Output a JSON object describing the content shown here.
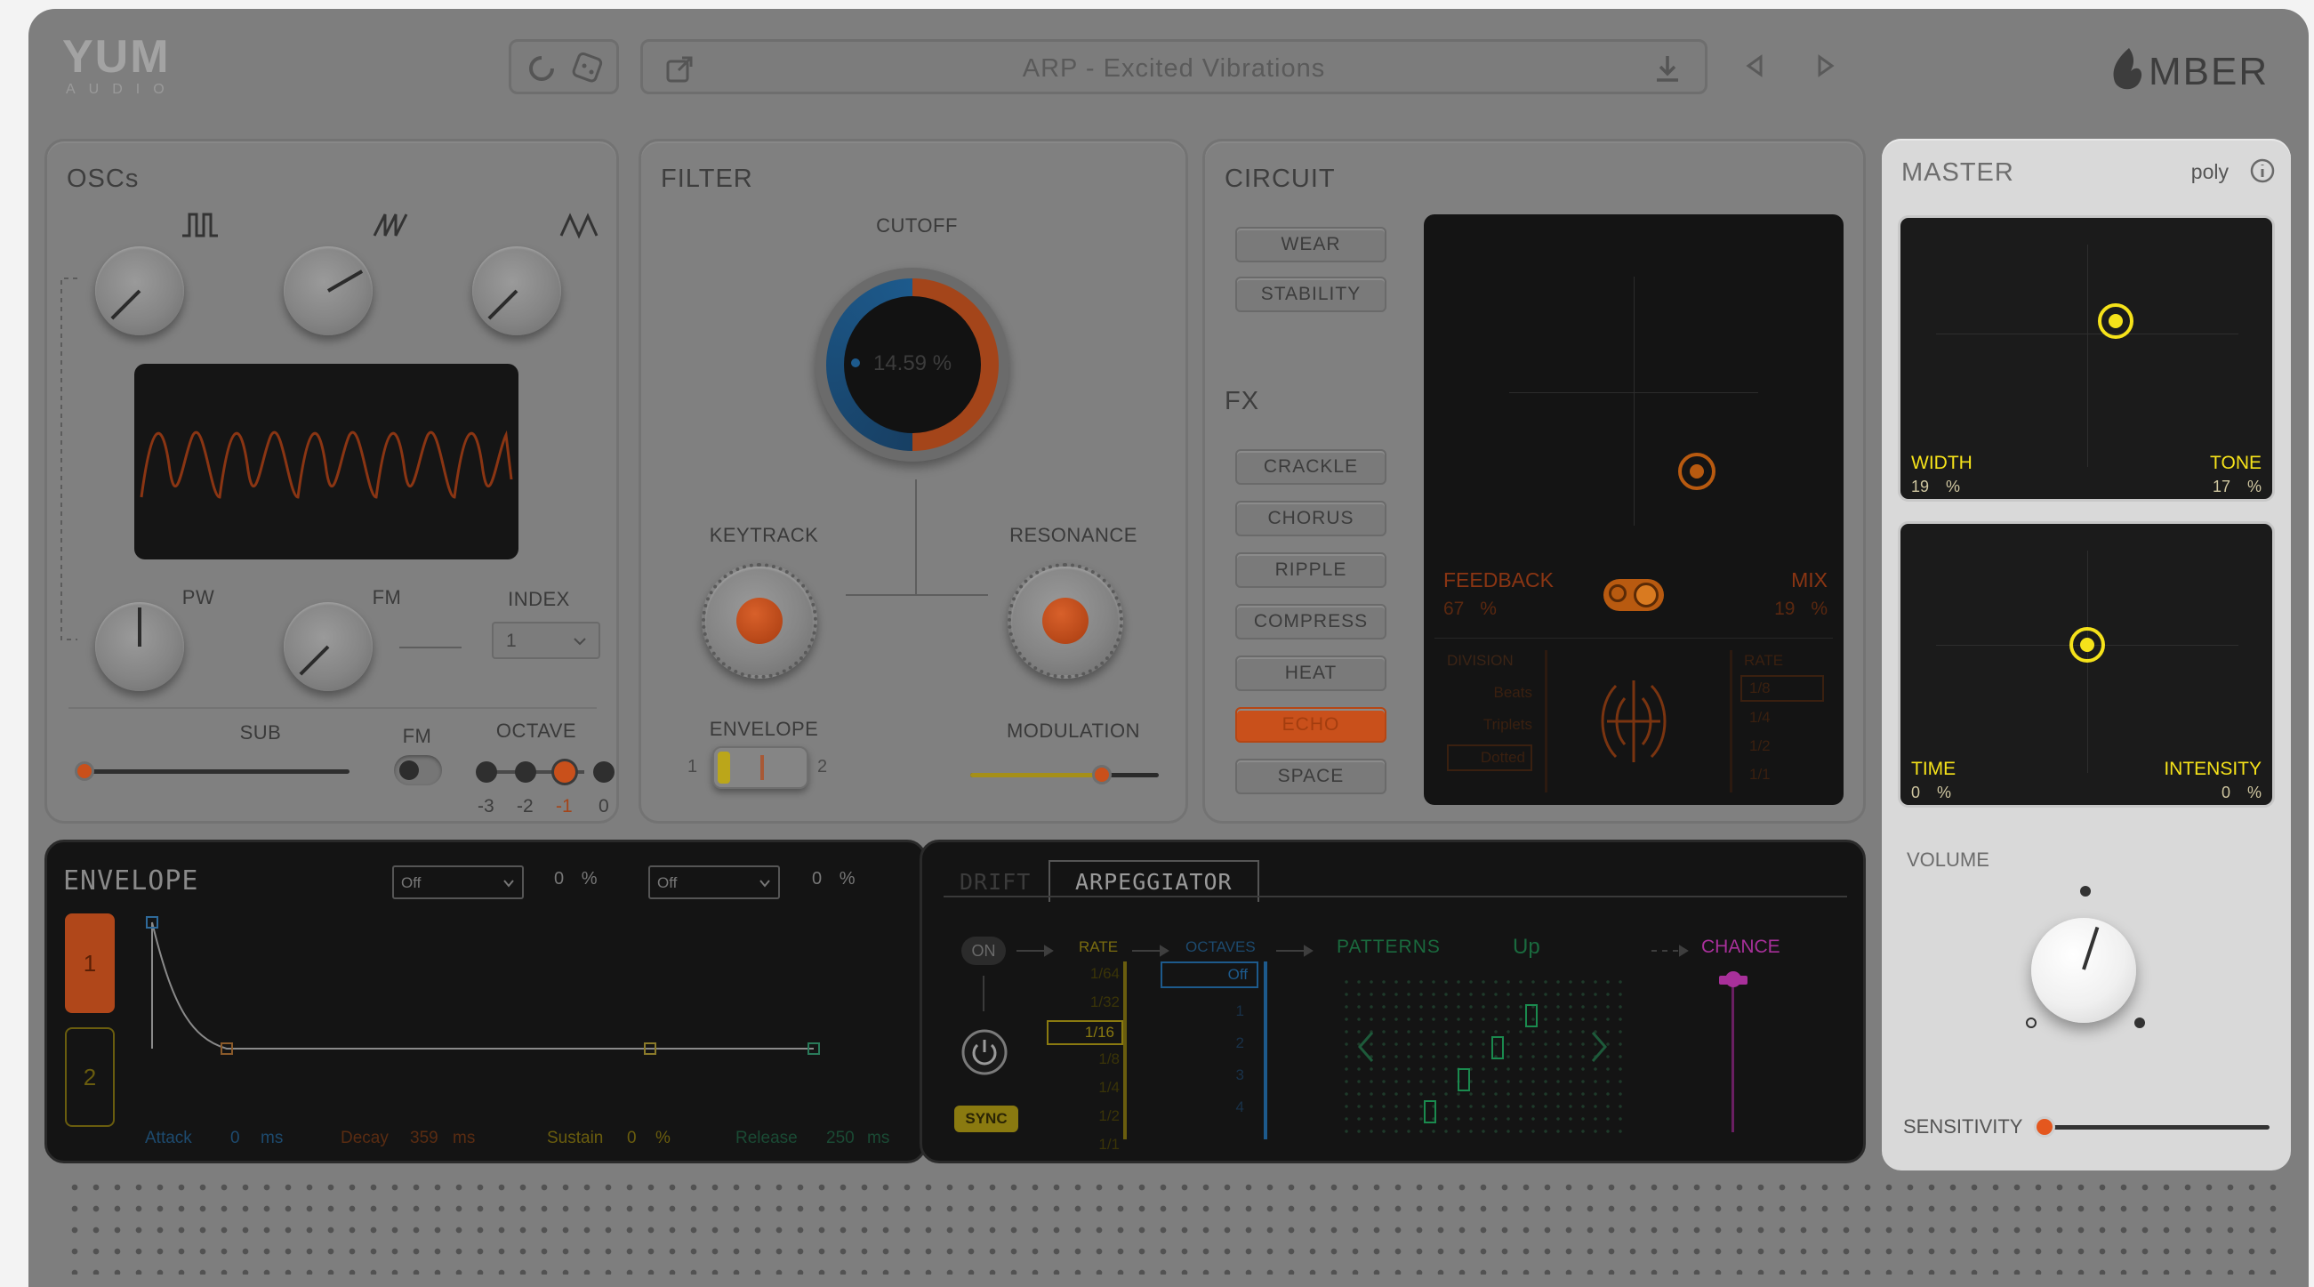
{
  "header": {
    "logo_main": "YUM",
    "logo_sub": "AUDIO",
    "preset_name": "ARP - Excited Vibrations",
    "brand": "MBER"
  },
  "oscs": {
    "title": "OSCs",
    "pw_label": "PW",
    "fm_label": "FM",
    "index_label": "INDEX",
    "index_value": "1",
    "sub_label": "SUB",
    "fm2_label": "FM",
    "octave_label": "OCTAVE",
    "octave_values": [
      "-3",
      "-2",
      "-1",
      "0"
    ],
    "octave_selected": 2
  },
  "filter": {
    "title": "FILTER",
    "cutoff_label": "CUTOFF",
    "cutoff_value": "14.59",
    "cutoff_unit": "%",
    "keytrack_label": "KEYTRACK",
    "resonance_label": "RESONANCE",
    "envelope_label": "ENVELOPE",
    "envelope_left": "1",
    "envelope_right": "2",
    "modulation_label": "MODULATION",
    "modulation_level": 0.7
  },
  "circuit": {
    "title": "CIRCUIT",
    "buttons": [
      "WEAR",
      "STABILITY"
    ],
    "fx_title": "FX",
    "fx_buttons": [
      "CRACKLE",
      "CHORUS",
      "RIPPLE",
      "COMPRESS",
      "HEAT",
      "ECHO",
      "SPACE"
    ],
    "fx_active": "ECHO",
    "feedback_label": "FEEDBACK",
    "feedback_value": "67",
    "mix_label": "MIX",
    "mix_value": "19",
    "percent": "%",
    "division_label": "DIVISION",
    "division_options": [
      "Beats",
      "Triplets",
      "Dotted"
    ],
    "rate_label": "RATE",
    "rate_options": [
      "1/8",
      "1/4",
      "1/2",
      "1/1"
    ]
  },
  "master": {
    "title": "MASTER",
    "mode": "poly",
    "width_label": "WIDTH",
    "width_value": "19",
    "tone_label": "TONE",
    "tone_value": "17",
    "time_label": "TIME",
    "time_value": "0",
    "intensity_label": "INTENSITY",
    "intensity_value": "0",
    "percent": "%",
    "volume_label": "VOLUME",
    "sensitivity_label": "SENSITIVITY",
    "accent": "#f5e21a"
  },
  "envelope": {
    "title": "ENVELOPE",
    "select1": "Off",
    "pct1": "0",
    "select2": "Off",
    "pct2": "0",
    "percent": "%",
    "env_buttons": [
      "1",
      "2"
    ],
    "attack_label": "Attack",
    "attack_value": "0",
    "attack_unit": "ms",
    "decay_label": "Decay",
    "decay_value": "359",
    "decay_unit": "ms",
    "sustain_label": "Sustain",
    "sustain_value": "0",
    "sustain_unit": "%",
    "release_label": "Release",
    "release_value": "250",
    "release_unit": "ms"
  },
  "arp": {
    "tab_drift": "DRIFT",
    "tab_arp": "ARPEGGIATOR",
    "on_label": "ON",
    "sync_label": "SYNC",
    "rate_label": "RATE",
    "rate_options": [
      "1/64",
      "1/32",
      "1/16",
      "1/8",
      "1/4",
      "1/2",
      "1/1"
    ],
    "rate_selected": "1/16",
    "octaves_label": "OCTAVES",
    "octaves_options": [
      "Off",
      "1",
      "2",
      "3",
      "4"
    ],
    "patterns_label": "PATTERNS",
    "pattern_value": "Up",
    "chance_label": "CHANCE"
  },
  "colors": {
    "orange": "#c9501b",
    "yellow": "#d9c41a",
    "blue": "#2f86c4",
    "green": "#2a9a55",
    "magenta": "#b23aa8",
    "panel": "#808080"
  }
}
